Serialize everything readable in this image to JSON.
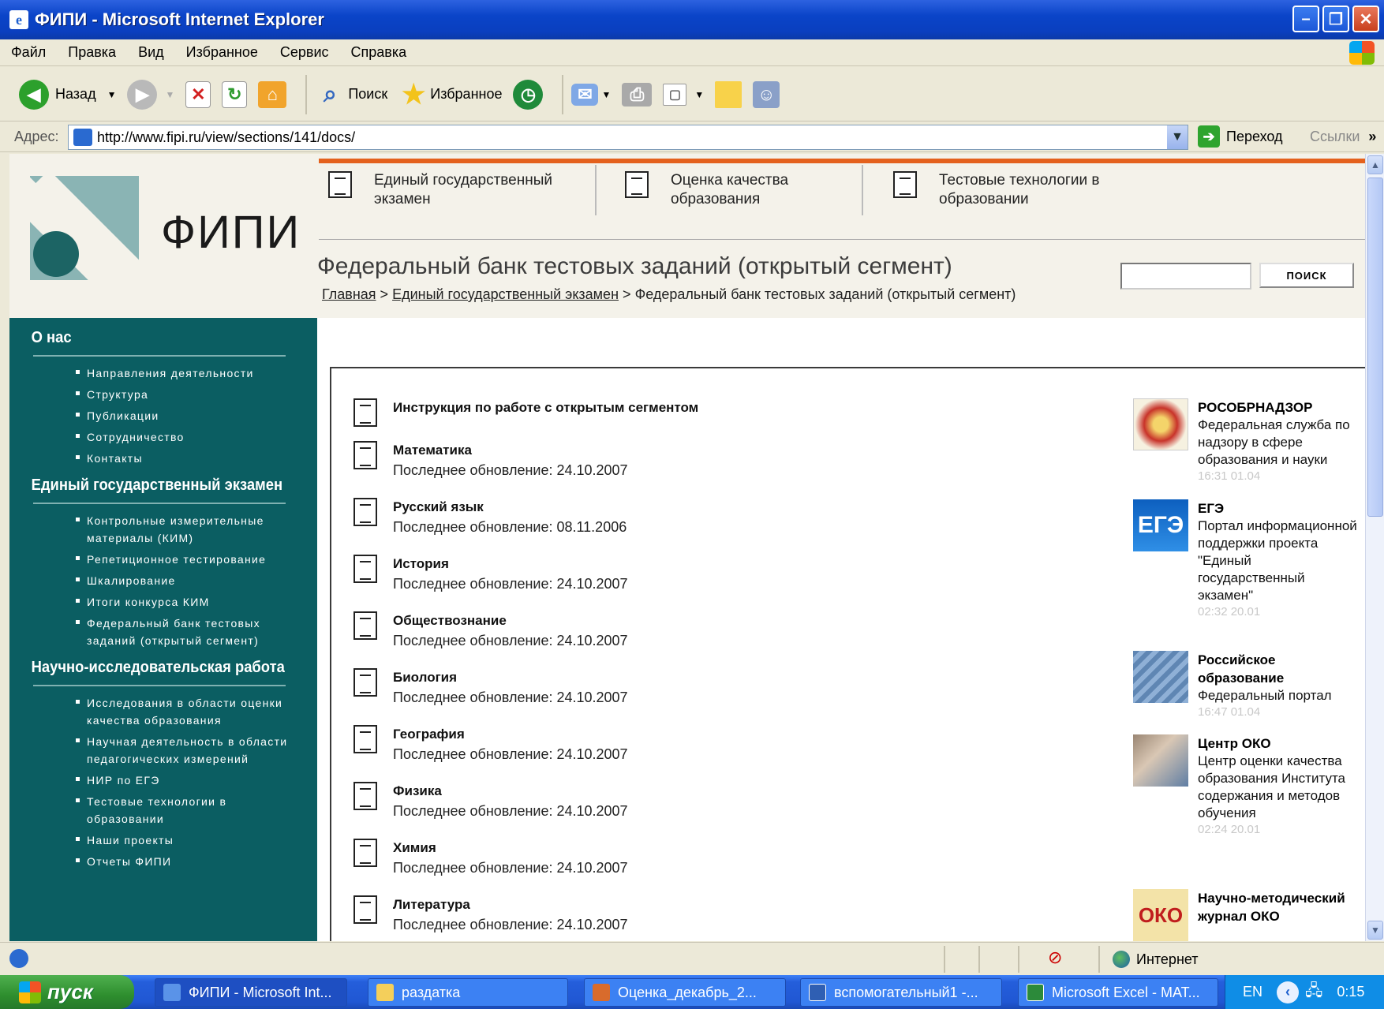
{
  "window": {
    "title": "ФИПИ - Microsoft Internet Explorer"
  },
  "menu": [
    "Файл",
    "Правка",
    "Вид",
    "Избранное",
    "Сервис",
    "Справка"
  ],
  "toolbar": {
    "back": "Назад",
    "search": "Поиск",
    "favorites": "Избранное"
  },
  "address": {
    "label": "Адрес:",
    "url": "http://www.fipi.ru/view/sections/141/docs/",
    "go": "Переход",
    "links": "Ссылки"
  },
  "site": {
    "logo": "ФИПИ",
    "topnav": [
      {
        "l1": "Единый государственный",
        "l2": "экзамен"
      },
      {
        "l1": "Оценка качества",
        "l2": "образования"
      },
      {
        "l1": "Тестовые технологии в",
        "l2": "образовании"
      }
    ],
    "page_title": "Федеральный банк тестовых заданий (открытый сегмент)",
    "breadcrumb": {
      "home": "Главная",
      "sep": ">",
      "ege": "Единый государственный экзамен",
      "current": "Федеральный банк тестовых заданий (открытый сегмент)"
    },
    "search_button": "ПОИСК"
  },
  "sidebar": [
    {
      "heading": "О нас",
      "items": [
        "Направления деятельности",
        "Структура",
        "Публикации",
        "Сотрудничество",
        "Контакты"
      ]
    },
    {
      "heading": "Единый государственный экзамен",
      "items": [
        "Контрольные измерительные материалы (КИМ)",
        "Репетиционное тестирование",
        "Шкалирование",
        "Итоги конкурса КИМ",
        "Федеральный банк тестовых заданий (открытый сегмент)"
      ]
    },
    {
      "heading": "Научно-исследовательская работа",
      "items": [
        "Исследования в области оценки качества образования",
        "Научная деятельность в области педагогических измерений",
        "НИР по ЕГЭ",
        "Тестовые технологии в образовании",
        "Наши проекты",
        "Отчеты ФИПИ"
      ]
    }
  ],
  "docs": [
    {
      "title": "Инструкция по работе с открытым сегментом",
      "date": ""
    },
    {
      "title": "Математика",
      "date": "Последнее обновление: 24.10.2007"
    },
    {
      "title": "Русский язык",
      "date": "Последнее обновление: 08.11.2006"
    },
    {
      "title": "История",
      "date": "Последнее обновление: 24.10.2007"
    },
    {
      "title": "Обществознание",
      "date": "Последнее обновление: 24.10.2007"
    },
    {
      "title": "Биология",
      "date": "Последнее обновление: 24.10.2007"
    },
    {
      "title": "География",
      "date": "Последнее обновление: 24.10.2007"
    },
    {
      "title": "Физика",
      "date": "Последнее обновление: 24.10.2007"
    },
    {
      "title": "Химия",
      "date": "Последнее обновление: 24.10.2007"
    },
    {
      "title": "Литература",
      "date": "Последнее обновление: 24.10.2007"
    }
  ],
  "news": [
    {
      "title": "РОСОБРНАДЗОР",
      "desc": "Федеральная служба по надзору в сфере образования и науки",
      "time": "16:31 01.04"
    },
    {
      "title": "ЕГЭ",
      "desc": "Портал информационной поддержки проекта \"Единый государственный экзамен\"",
      "time": "02:32 20.01"
    },
    {
      "title": "Российское образование",
      "desc": "Федеральный портал",
      "time": "16:47 01.04"
    },
    {
      "title": "Центр ОКО",
      "desc": "Центр оценки качества образования Института содержания и методов обучения",
      "time": "02:24 20.01"
    },
    {
      "title": "Научно-методический журнал ОКО",
      "desc": "",
      "time": ""
    }
  ],
  "status": {
    "zone": "Интернет"
  },
  "taskbar": {
    "start": "пуск",
    "tasks": [
      "ФИПИ - Microsoft Int...",
      "раздатка",
      "Оценка_декабрь_2...",
      "вспомогательный1 -...",
      "Microsoft Excel - МАТ..."
    ],
    "lang": "EN",
    "clock": "0:15"
  }
}
